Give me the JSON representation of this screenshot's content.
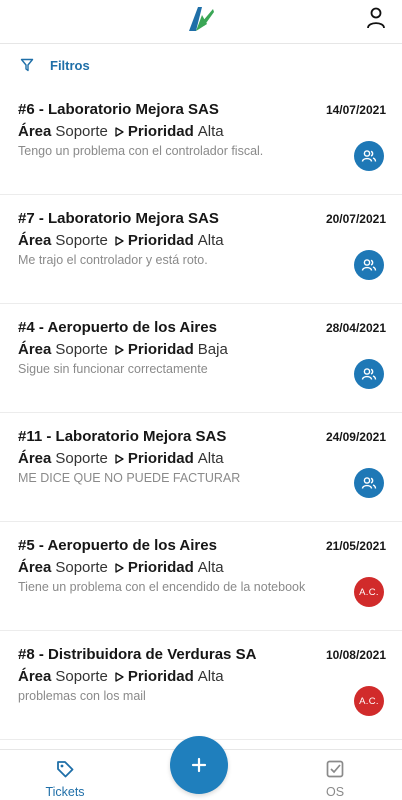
{
  "header": {
    "logo": "brand-logo",
    "profile_icon": "user-icon"
  },
  "filters": {
    "label": "Filtros",
    "icon": "filter-icon"
  },
  "labels": {
    "area": "Área",
    "priority": "Prioridad"
  },
  "tickets": [
    {
      "title": "#6 - Laboratorio Mejora SAS",
      "date": "14/07/2021",
      "area": "Soporte",
      "priority": "Alta",
      "description": "Tengo un problema con el controlador fiscal.",
      "assignee_type": "group",
      "assignee_text": ""
    },
    {
      "title": "#7 - Laboratorio Mejora SAS",
      "date": "20/07/2021",
      "area": "Soporte",
      "priority": "Alta",
      "description": "Me trajo el controlador y está roto.",
      "assignee_type": "group",
      "assignee_text": ""
    },
    {
      "title": "#4 - Aeropuerto de los Aires",
      "date": "28/04/2021",
      "area": "Soporte",
      "priority": "Baja",
      "description": "Sigue sin funcionar correctamente",
      "assignee_type": "group",
      "assignee_text": ""
    },
    {
      "title": "#11 - Laboratorio Mejora SAS",
      "date": "24/09/2021",
      "area": "Soporte",
      "priority": "Alta",
      "description": "ME DICE QUE NO PUEDE FACTURAR",
      "assignee_type": "group",
      "assignee_text": ""
    },
    {
      "title": "#5 - Aeropuerto de los Aires",
      "date": "21/05/2021",
      "area": "Soporte",
      "priority": "Alta",
      "description": "Tiene un problema con el encendido de la notebook",
      "assignee_type": "user",
      "assignee_text": "A.C."
    },
    {
      "title": "#8 - Distribuidora de Verduras SA",
      "date": "10/08/2021",
      "area": "Soporte",
      "priority": "Alta",
      "description": "problemas con los mail",
      "assignee_type": "user",
      "assignee_text": "A.C."
    }
  ],
  "bottom_nav": {
    "tickets_label": "Tickets",
    "os_label": "OS",
    "fab_icon": "plus-icon"
  },
  "colors": {
    "accent": "#1f6fa8",
    "group_badge": "#1e78b6",
    "user_badge": "#d12b2b"
  }
}
